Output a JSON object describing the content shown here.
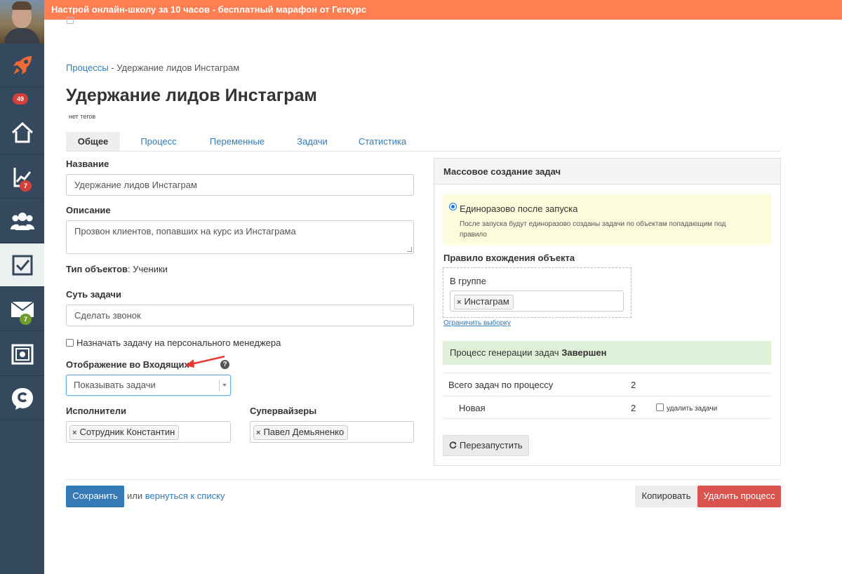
{
  "banner": {
    "text": "Настрой онлайн-школу за 10 часов - бесплатный марафон от Геткурс"
  },
  "sidebar": {
    "badges": {
      "dashboard": "49",
      "analytics": "7",
      "mail": "7"
    },
    "icons": [
      "avatar",
      "rocket-icon",
      "home-icon",
      "chart-icon",
      "users-icon",
      "tasks-icon",
      "mail-icon",
      "safe-icon",
      "chat-icon"
    ]
  },
  "breadcrumb": {
    "root": "Процессы",
    "sep": "-",
    "current": "Удержание лидов Инстаграм"
  },
  "page": {
    "title": "Удержание лидов Инстаграм",
    "tags": "нет тегов"
  },
  "tabs": [
    {
      "label": "Общее"
    },
    {
      "label": "Процесс"
    },
    {
      "label": "Переменные"
    },
    {
      "label": "Задачи"
    },
    {
      "label": "Статистика"
    }
  ],
  "form": {
    "name_label": "Название",
    "name_value": "Удержание лидов Инстаграм",
    "description_label": "Описание",
    "description_value": "Прозвон клиентов, попавших на курс из Инстаграма",
    "object_type_label": "Тип объектов",
    "object_type_value": ": Ученики",
    "task_essence_label": "Суть задачи",
    "task_essence_value": "Сделать звонок",
    "personal_manager_label": "Назначать задачу на персонального менеджера",
    "inbox_display_label": "Отображение во Входящих",
    "inbox_display_value": "Показывать задачи",
    "help": "?",
    "executors_label": "Исполнители",
    "executors": [
      "Сотрудник Константин"
    ],
    "supervisors_label": "Супервайзеры",
    "supervisors": [
      "Павел Демьяненко"
    ],
    "chip_remove": "×"
  },
  "panel": {
    "title": "Массовое создание задач",
    "mode_label": "Единоразово после запуска",
    "mode_desc": "После запуска будут единоразово созданы задачи по объектам попадающим под правило",
    "rule_label": "Правило вхождения объекта",
    "group_label": "В группе",
    "group_chip": "Инстаграм",
    "limit_link": "Ограничить выборку",
    "status_prefix": "Процесс генерации задач",
    "status_value": "Завершен",
    "total_label": "Всего задач по процессу",
    "total_value": "2",
    "new_label": "Новая",
    "new_value": "2",
    "delete_tasks_label": "удалить задачи",
    "restart_label": "Перезапустить"
  },
  "footer": {
    "save_label": "Сохранить",
    "or_text": "или",
    "back_link": "вернуться к списку",
    "copy_label": "Копировать",
    "delete_label": "Удалить процесс"
  },
  "colors": {
    "banner": "#ff7e52",
    "sidebar": "#34495e",
    "primary": "#337ab7",
    "danger": "#d9534f",
    "notice": "#fcfbdc",
    "success": "#dff0d8"
  }
}
